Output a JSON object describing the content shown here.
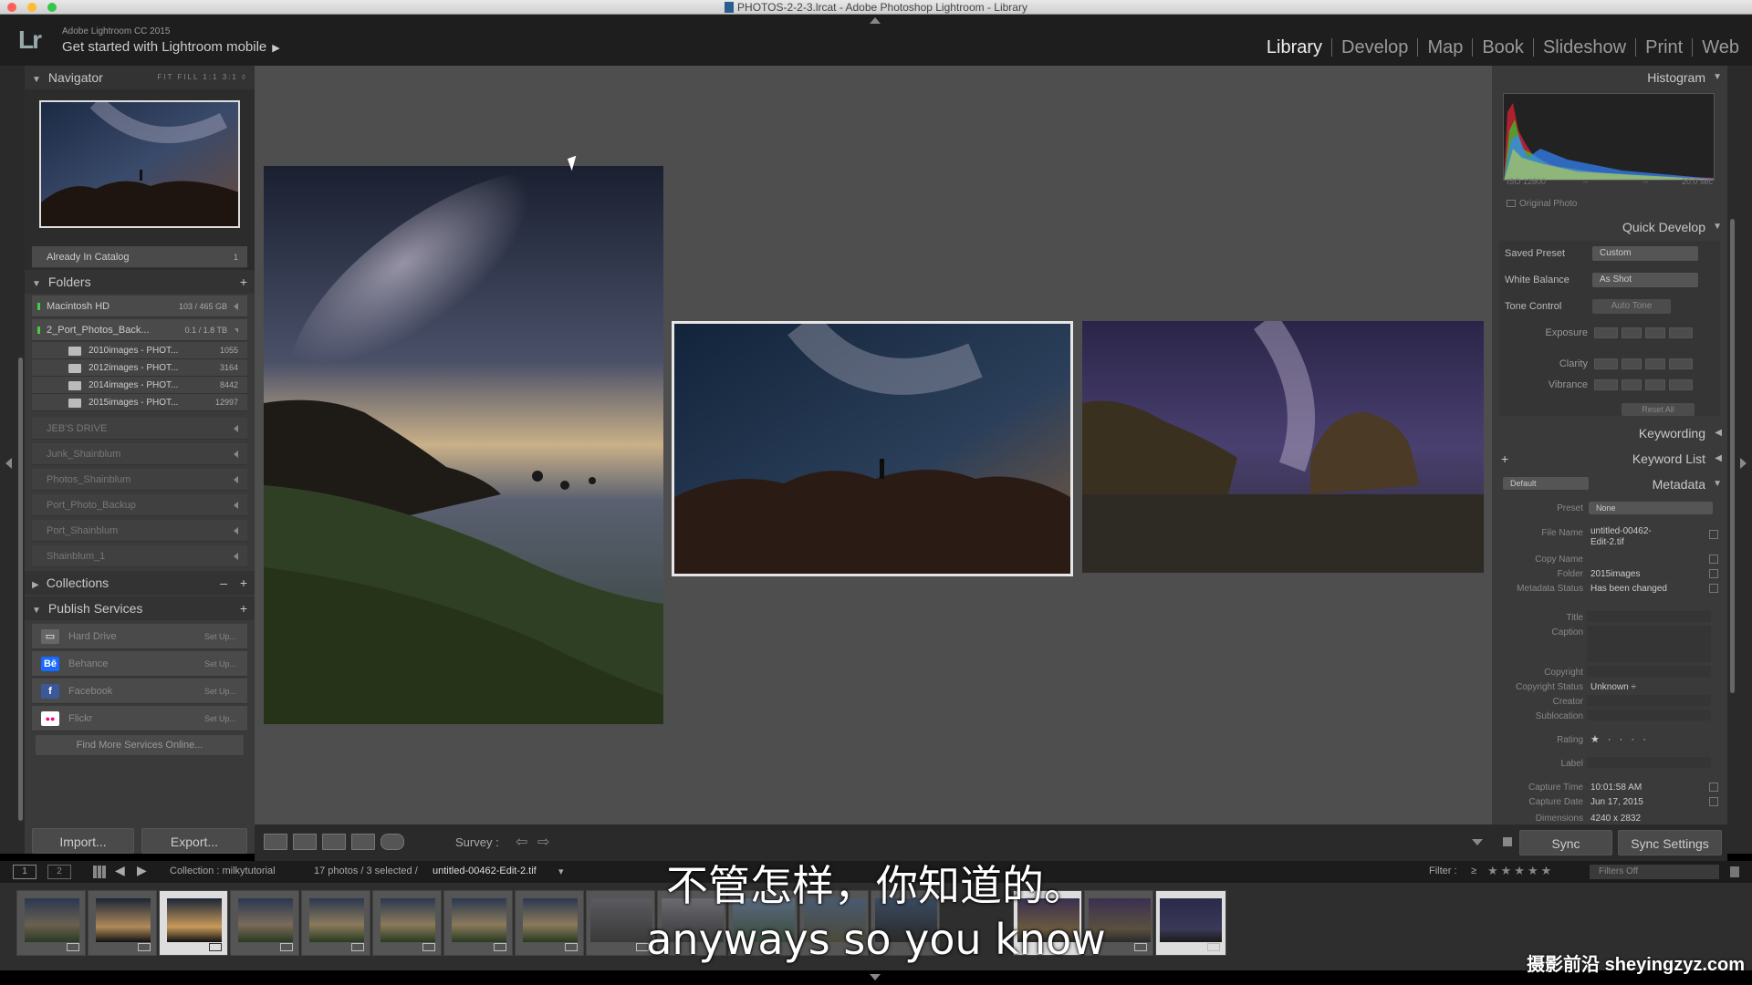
{
  "window": {
    "title": "PHOTOS-2-2-3.lrcat - Adobe Photoshop Lightroom - Library"
  },
  "identity": {
    "logo": "Lr",
    "version": "Adobe Lightroom CC 2015",
    "mobile_prompt": "Get started with Lightroom mobile",
    "mobile_arrow": "▶"
  },
  "modules": [
    "Library",
    "Develop",
    "Map",
    "Book",
    "Slideshow",
    "Print",
    "Web"
  ],
  "active_module": "Library",
  "left": {
    "navigator": {
      "title": "Navigator",
      "zoom": "FIT  FILL  1:1  3:1 ◊"
    },
    "catalog_row": {
      "label": "Already In Catalog",
      "count": "1"
    },
    "folders": {
      "title": "Folders",
      "volumes": [
        {
          "name": "Macintosh HD",
          "info": "103 / 465 GB"
        },
        {
          "name": "2_Port_Photos_Back...",
          "info": "0.1 / 1.8 TB"
        }
      ],
      "items": [
        {
          "name": "2010images - PHOT...",
          "count": "1055"
        },
        {
          "name": "2012images - PHOT...",
          "count": "3164"
        },
        {
          "name": "2014images - PHOT...",
          "count": "8442"
        },
        {
          "name": "2015images - PHOT...",
          "count": "12997"
        }
      ],
      "offline": [
        "JEB'S DRIVE",
        "Junk_Shainblum",
        "Photos_Shainblum",
        "Port_Photo_Backup",
        "Port_Shainblum",
        "Shainblum_1"
      ]
    },
    "collections": {
      "title": "Collections",
      "minus": "–",
      "plus": "+"
    },
    "publish": {
      "title": "Publish Services",
      "plus": "+",
      "services": [
        {
          "name": "Hard Drive",
          "icon": "hard-drive-icon",
          "glyph": "▭",
          "color": "#666666",
          "action": "Set Up..."
        },
        {
          "name": "Behance",
          "icon": "behance-icon",
          "glyph": "Bē",
          "color": "#1769ff",
          "action": "Set Up..."
        },
        {
          "name": "Facebook",
          "icon": "facebook-icon",
          "glyph": "f",
          "color": "#3b5998",
          "action": "Set Up..."
        },
        {
          "name": "Flickr",
          "icon": "flickr-icon",
          "glyph": "●●",
          "color": "#2a2a2a",
          "action": "Set Up..."
        }
      ],
      "find_more": "Find More Services Online..."
    },
    "import_label": "Import...",
    "export_label": "Export..."
  },
  "toolbar": {
    "survey_label": "Survey :",
    "prev": "⇦",
    "next": "⇨"
  },
  "right": {
    "histogram": {
      "title": "Histogram",
      "iso": "ISO 12800",
      "dash1": "–",
      "dash2": "–",
      "shutter": "20.0 sec",
      "original_photo": "Original Photo"
    },
    "quick_develop": {
      "title": "Quick Develop",
      "saved_preset_label": "Saved Preset",
      "saved_preset_value": "Custom",
      "white_balance_label": "White Balance",
      "white_balance_value": "As Shot",
      "tone_control_label": "Tone Control",
      "auto_tone": "Auto Tone",
      "exposure_label": "Exposure",
      "clarity_label": "Clarity",
      "vibrance_label": "Vibrance",
      "reset_all": "Reset All"
    },
    "keywording": "Keywording",
    "keyword_list": "Keyword List",
    "keyword_plus": "+",
    "metadata": {
      "title": "Metadata",
      "preset_dd": "Default",
      "preset_label": "Preset",
      "preset_value": "None",
      "fields": [
        {
          "label": "File Name",
          "value": "untitled-00462-\nEdit-2.tif"
        },
        {
          "label": "Copy Name",
          "value": ""
        },
        {
          "label": "Folder",
          "value": "2015images"
        },
        {
          "label": "Metadata Status",
          "value": "Has been changed"
        },
        {
          "label": "Title",
          "value": ""
        },
        {
          "label": "Caption",
          "value": ""
        },
        {
          "label": "Copyright",
          "value": ""
        },
        {
          "label": "Copyright Status",
          "value": "Unknown ÷"
        },
        {
          "label": "Creator",
          "value": ""
        },
        {
          "label": "Sublocation",
          "value": ""
        },
        {
          "label": "Rating",
          "value": "★ · · · ·"
        },
        {
          "label": "Label",
          "value": ""
        },
        {
          "label": "Capture Time",
          "value": "10:01:58 AM"
        },
        {
          "label": "Capture Date",
          "value": "Jun 17, 2015"
        },
        {
          "label": "Dimensions",
          "value": "4240 x 2832"
        }
      ]
    },
    "sync_label": "Sync",
    "sync_settings_label": "Sync Settings"
  },
  "filmbar": {
    "view1": "1",
    "view2": "2",
    "collection_text": "Collection : milkytutorial",
    "count_text": "17 photos / 3 selected /",
    "file_text": "untitled-00462-Edit-2.tif",
    "file_caret": "▾",
    "filter_label": "Filter :",
    "filter_op": "≥",
    "filters_off": "Filters Off"
  },
  "subtitles": {
    "cn": "不管怎样，你知道的。",
    "en": "anyways so you know"
  },
  "watermark": "摄影前沿 sheyingzyz.com"
}
